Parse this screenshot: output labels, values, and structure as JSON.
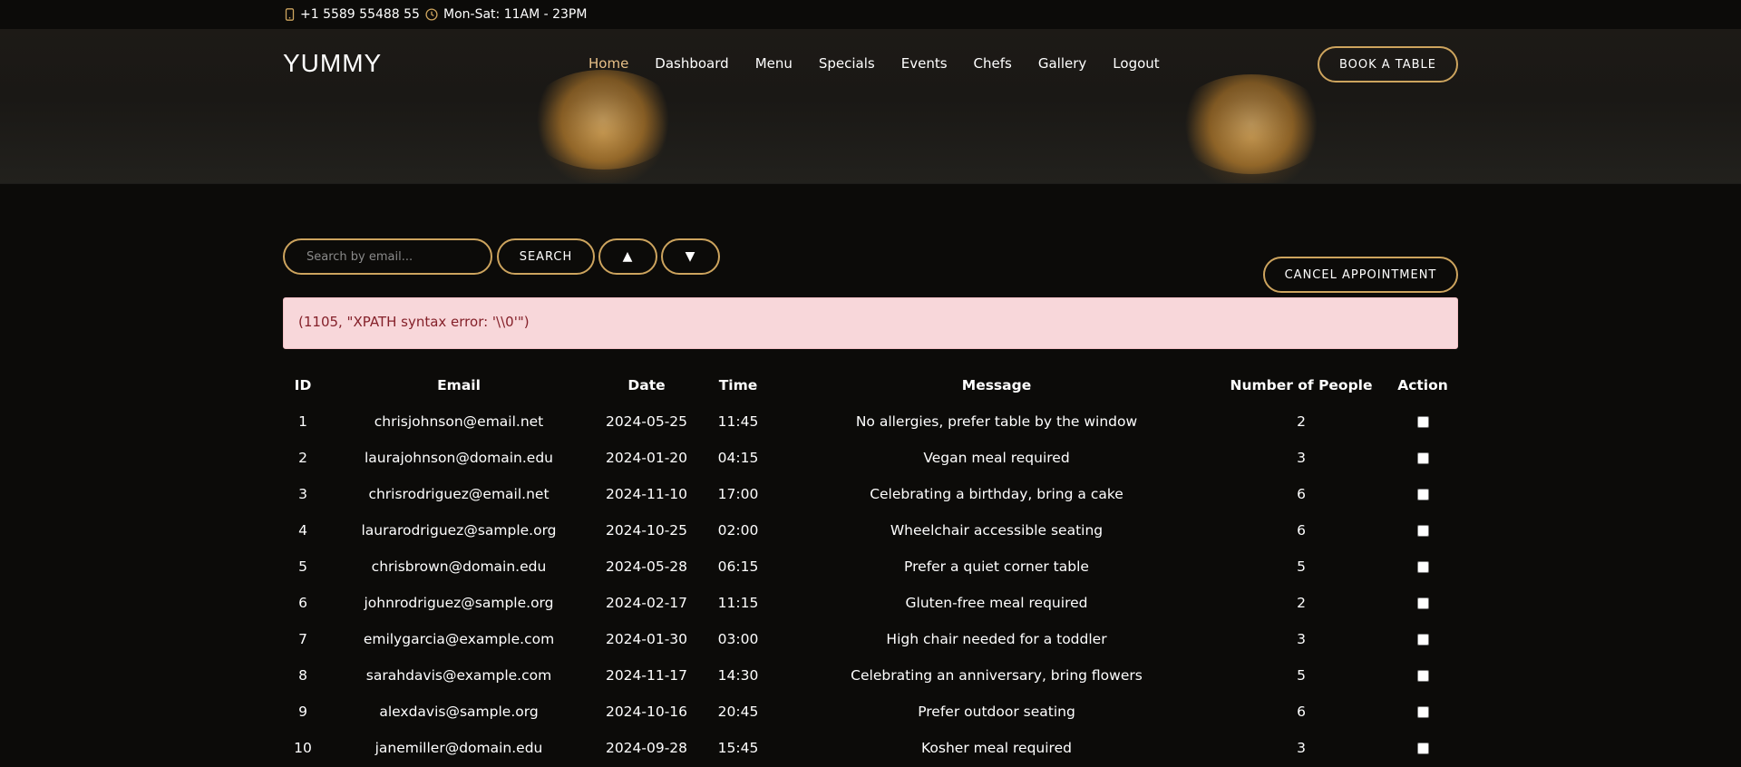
{
  "topbar": {
    "phone": "+1 5589 55488 55",
    "hours": "Mon-Sat: 11AM - 23PM"
  },
  "header": {
    "logo": "YUMMY",
    "nav": [
      "Home",
      "Dashboard",
      "Menu",
      "Specials",
      "Events",
      "Chefs",
      "Gallery",
      "Logout"
    ],
    "active_nav": "Home",
    "book_button": "BOOK A TABLE"
  },
  "controls": {
    "search_placeholder": "Search by email...",
    "search_button": "SEARCH",
    "sort_up": "▲",
    "sort_down": "▼",
    "cancel_button": "CANCEL APPOINTMENT"
  },
  "alert": {
    "message": "(1105, \"XPATH syntax error: '\\\\0'\")"
  },
  "table": {
    "headers": [
      "ID",
      "Email",
      "Date",
      "Time",
      "Message",
      "Number of People",
      "Action"
    ],
    "rows": [
      [
        "1",
        "chrisjohnson@email.net",
        "2024-05-25",
        "11:45",
        "No allergies, prefer table by the window",
        "2"
      ],
      [
        "2",
        "laurajohnson@domain.edu",
        "2024-01-20",
        "04:15",
        "Vegan meal required",
        "3"
      ],
      [
        "3",
        "chrisrodriguez@email.net",
        "2024-11-10",
        "17:00",
        "Celebrating a birthday, bring a cake",
        "6"
      ],
      [
        "4",
        "laurarodriguez@sample.org",
        "2024-10-25",
        "02:00",
        "Wheelchair accessible seating",
        "6"
      ],
      [
        "5",
        "chrisbrown@domain.edu",
        "2024-05-28",
        "06:15",
        "Prefer a quiet corner table",
        "5"
      ],
      [
        "6",
        "johnrodriguez@sample.org",
        "2024-02-17",
        "11:15",
        "Gluten-free meal required",
        "2"
      ],
      [
        "7",
        "emilygarcia@example.com",
        "2024-01-30",
        "03:00",
        "High chair needed for a toddler",
        "3"
      ],
      [
        "8",
        "sarahdavis@example.com",
        "2024-11-17",
        "14:30",
        "Celebrating an anniversary, bring flowers",
        "5"
      ],
      [
        "9",
        "alexdavis@sample.org",
        "2024-10-16",
        "20:45",
        "Prefer outdoor seating",
        "6"
      ],
      [
        "10",
        "janemiller@domain.edu",
        "2024-09-28",
        "15:45",
        "Kosher meal required",
        "3"
      ]
    ]
  },
  "colors": {
    "background": "#0c0b09",
    "accent": "#cda45e",
    "active_nav": "#e8c088",
    "alert_bg": "#f8d7da",
    "alert_text": "#842029"
  }
}
